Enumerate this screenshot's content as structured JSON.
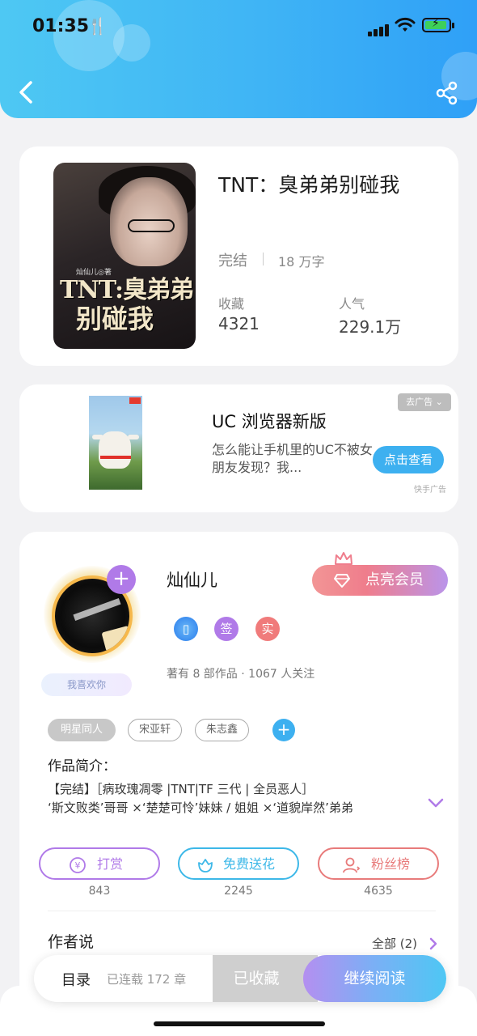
{
  "status_bar": {
    "time": "01:35"
  },
  "book": {
    "title": "TNT：臭弟弟别碰我",
    "status": "完结",
    "words": "18 万字",
    "favorites_label": "收藏",
    "favorites_value": "4321",
    "popularity_label": "人气",
    "popularity_value": "229.1万",
    "cover": {
      "line1": "TNT:臭弟弟",
      "line2": "别碰我",
      "author_mark": "灿仙儿◎著"
    }
  },
  "ad": {
    "title": "UC 浏览器新版",
    "description": "怎么能让手机里的UC不被女朋友发现？我...",
    "close_label": "去广告",
    "button_label": "点击查看",
    "source": "快手广告"
  },
  "author": {
    "name": "灿仙儿",
    "vip_label": "点亮会员",
    "like_badge": "我喜欢你",
    "badges": [
      {
        "name": "reader-badge",
        "text": "",
        "color": "#3d8ef0"
      },
      {
        "name": "sign-badge",
        "text": "签",
        "color": "#b07ae8"
      },
      {
        "name": "real-badge",
        "text": "实",
        "color": "#f07b7b"
      }
    ],
    "works_info": "著有 8 部作品 · 1067 人关注"
  },
  "tags": [
    "明星同人",
    "宋亚轩",
    "朱志鑫"
  ],
  "intro": {
    "label": "作品简介：",
    "line1": "【完结】［病玫瑰凋零 |TNT|TF 三代 | 全员恶人］",
    "line2": "‘斯文败类’哥哥 ×‘楚楚可怜’妹妹 / 姐姐 ×‘道貌岸然’弟弟"
  },
  "actions": [
    {
      "label": "打赏",
      "count": "843",
      "color": "#b07ae8"
    },
    {
      "label": "免费送花",
      "count": "2245",
      "color": "#3db8e8"
    },
    {
      "label": "粉丝榜",
      "count": "4635",
      "color": "#e87b7b"
    }
  ],
  "author_says": {
    "label": "作者说",
    "all_label": "全部 (2)"
  },
  "bottom_bar": {
    "toc_label": "目录",
    "chapters_label": "已连载 172 章",
    "saved_label": "已收藏",
    "read_label": "继续阅读"
  },
  "colors": {
    "header_start": "#4ec8f3",
    "header_end": "#2fa0f7",
    "accent_blue": "#3db0f0",
    "accent_purple": "#b07ae8",
    "accent_red": "#ef7d8c"
  }
}
